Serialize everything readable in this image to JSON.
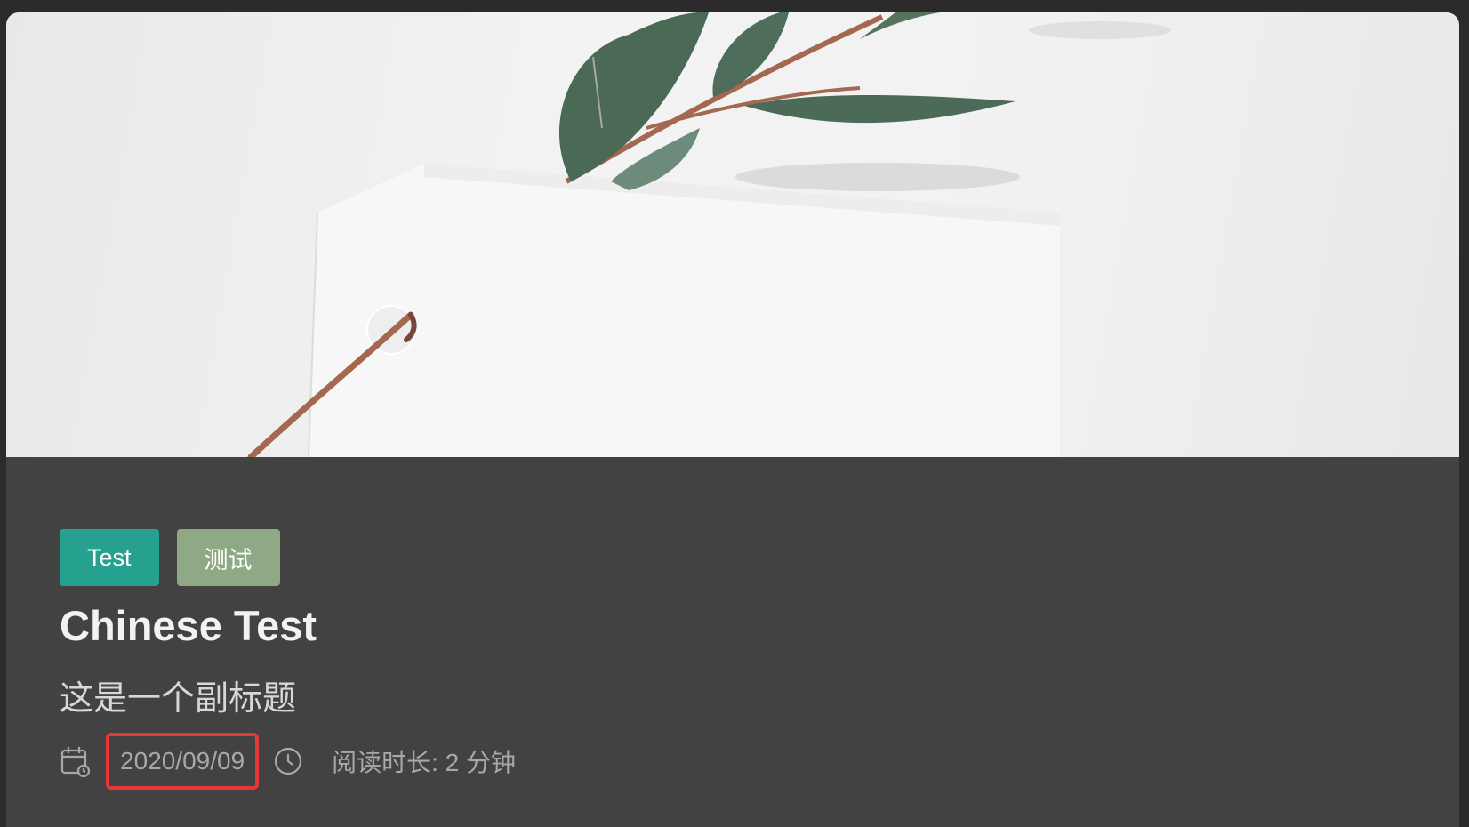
{
  "post": {
    "tags": [
      {
        "label": "Test",
        "color": "#26a08f"
      },
      {
        "label": "测试",
        "color": "#8fa985"
      }
    ],
    "title": "Chinese Test",
    "subtitle": "这是一个副标题",
    "meta": {
      "date": "2020/09/09",
      "reading_time": "阅读时长: 2 分钟",
      "calendar_icon": "calendar-icon",
      "clock_icon": "clock-icon"
    },
    "highlight_color": "#e53935"
  }
}
